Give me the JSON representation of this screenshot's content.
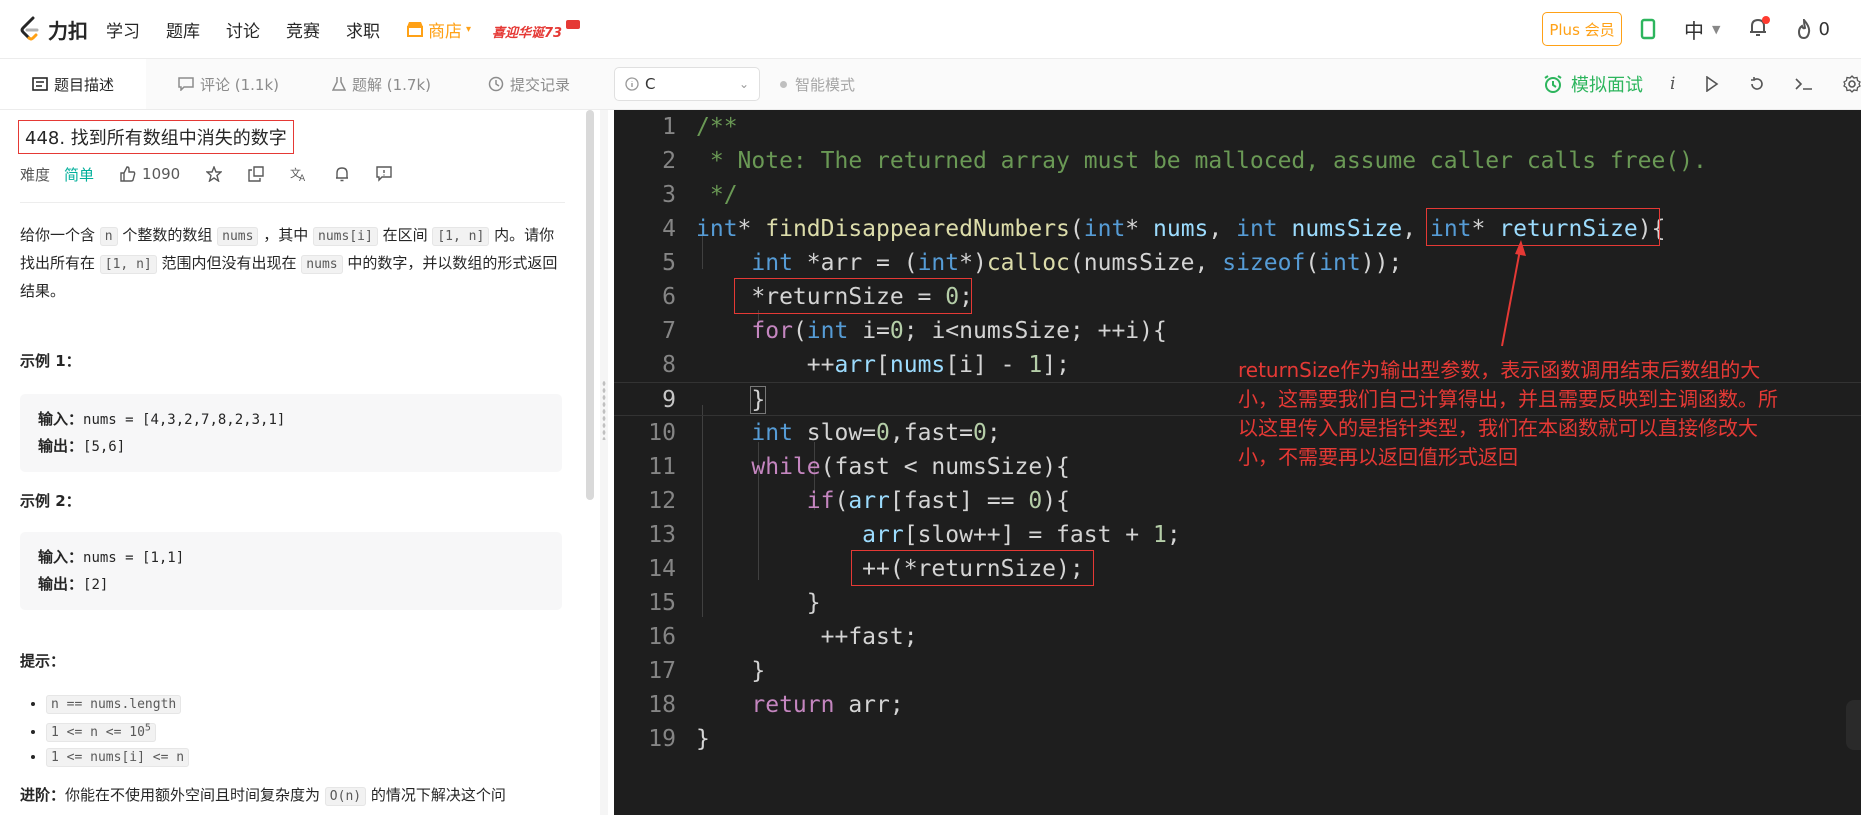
{
  "nav": {
    "logo_text": "力扣",
    "items": [
      "学习",
      "题库",
      "讨论",
      "竞赛",
      "求职"
    ],
    "store": "商店",
    "promo": "喜迎华诞73",
    "plus": "Plus 会员",
    "lang": "中",
    "fire_count": "0"
  },
  "tabs": [
    "题目描述",
    "评论 (1.1k)",
    "题解 (1.7k)",
    "提交记录"
  ],
  "problem": {
    "title": "448. 找到所有数组中消失的数字",
    "difficulty_label": "难度",
    "difficulty": "简单",
    "likes": "1090",
    "desc_parts": [
      "给你一个含 ",
      "n",
      " 个整数的数组 ",
      "nums",
      " ，其中 ",
      "nums[i]",
      " 在区间 ",
      "[1, n]",
      " 内。请你找出所有在 ",
      "[1, n]",
      " 范围内但没有出现在 ",
      "nums",
      " 中的数字，并以数组的形式返回结果。"
    ],
    "example1_title": "示例 1：",
    "example1_input_label": "输入：",
    "example1_input": "nums = [4,3,2,7,8,2,3,1]",
    "example1_output_label": "输出：",
    "example1_output": "[5,6]",
    "example2_title": "示例 2：",
    "example2_input_label": "输入：",
    "example2_input": "nums = [1,1]",
    "example2_output_label": "输出：",
    "example2_output": "[2]",
    "hints_title": "提示：",
    "hint1": "n == nums.length",
    "hint2_base": "1 <= n <= 10",
    "hint2_exp": "5",
    "hint3": "1 <= nums[i] <= n",
    "advance_label": "进阶：",
    "advance_text1": "你能在不使用额外空间且时间复杂度为 ",
    "advance_code": "O(n)",
    "advance_text2": " 的情况下解决这个问"
  },
  "editor": {
    "language": "C",
    "smart_mode": "智能模式",
    "mock_interview": "模拟面试",
    "line_numbers": [
      "1",
      "2",
      "3",
      "4",
      "5",
      "6",
      "7",
      "8",
      "9",
      "10",
      "11",
      "12",
      "13",
      "14",
      "15",
      "16",
      "17",
      "18",
      "19"
    ],
    "code_tokens": {
      "l1": "/**",
      "l2": " * Note: The returned array must be malloced, assume caller calls free().",
      "l3": " */",
      "l4_int1": "int",
      "l4_a": "* ",
      "l4_fn": "findDisappearedNumbers",
      "l4_b": "(",
      "l4_int2": "int",
      "l4_c": "* ",
      "l4_nums": "nums",
      "l4_d": ", ",
      "l4_int3": "int",
      "l4_e": " ",
      "l4_numsSize": "numsSize",
      "l4_f": ", ",
      "l4_int4": "int",
      "l4_g": "* ",
      "l4_returnSize": "returnSize",
      "l4_h": "){",
      "l5_int": "int",
      "l5_a": " *arr = (",
      "l5_int2": "int",
      "l5_b": "*)",
      "l5_fn": "calloc",
      "l5_c": "(numsSize, ",
      "l5_sizeof": "sizeof",
      "l5_d": "(",
      "l5_int3": "int",
      "l5_e": "));",
      "l6_a": "*returnSize = ",
      "l6_num": "0",
      "l6_b": ";",
      "l7_for": "for",
      "l7_a": "(",
      "l7_int": "int",
      "l7_b": " i=",
      "l7_num": "0",
      "l7_c": "; i<numsSize; ++i){",
      "l8_a": "++",
      "l8_arr": "arr",
      "l8_b": "[",
      "l8_nums": "nums",
      "l8_c": "[i] - ",
      "l8_num": "1",
      "l8_d": "];",
      "l9": "}",
      "l10_int": "int",
      "l10_a": " slow=",
      "l10_n1": "0",
      "l10_b": ",fast=",
      "l10_n2": "0",
      "l10_c": ";",
      "l11_while": "while",
      "l11_a": "(fast < numsSize){",
      "l12_if": "if",
      "l12_a": "(",
      "l12_arr": "arr",
      "l12_b": "[fast] == ",
      "l12_num": "0",
      "l12_c": "){",
      "l13_arr": "arr",
      "l13_a": "[slow++] = fast + ",
      "l13_num": "1",
      "l13_b": ";",
      "l14": "++(*returnSize);",
      "l15": "}",
      "l16": "++fast;",
      "l17": "}",
      "l18_ret": "return",
      "l18_a": " arr;",
      "l19": "}"
    },
    "annotation": "returnSize作为输出型参数，表示函数调用结束后数组的大小，这需要我们自己计算得出，并且需要反映到主调函数。所以这里传入的是指针类型，我们在本函数就可以直接修改大小，不需要再以返回值形式返回"
  },
  "colors": {
    "accent_orange": "#ffa116",
    "easy_green": "#00af9b",
    "annotation_red": "#e53935",
    "editor_bg": "#1e1e1e"
  }
}
